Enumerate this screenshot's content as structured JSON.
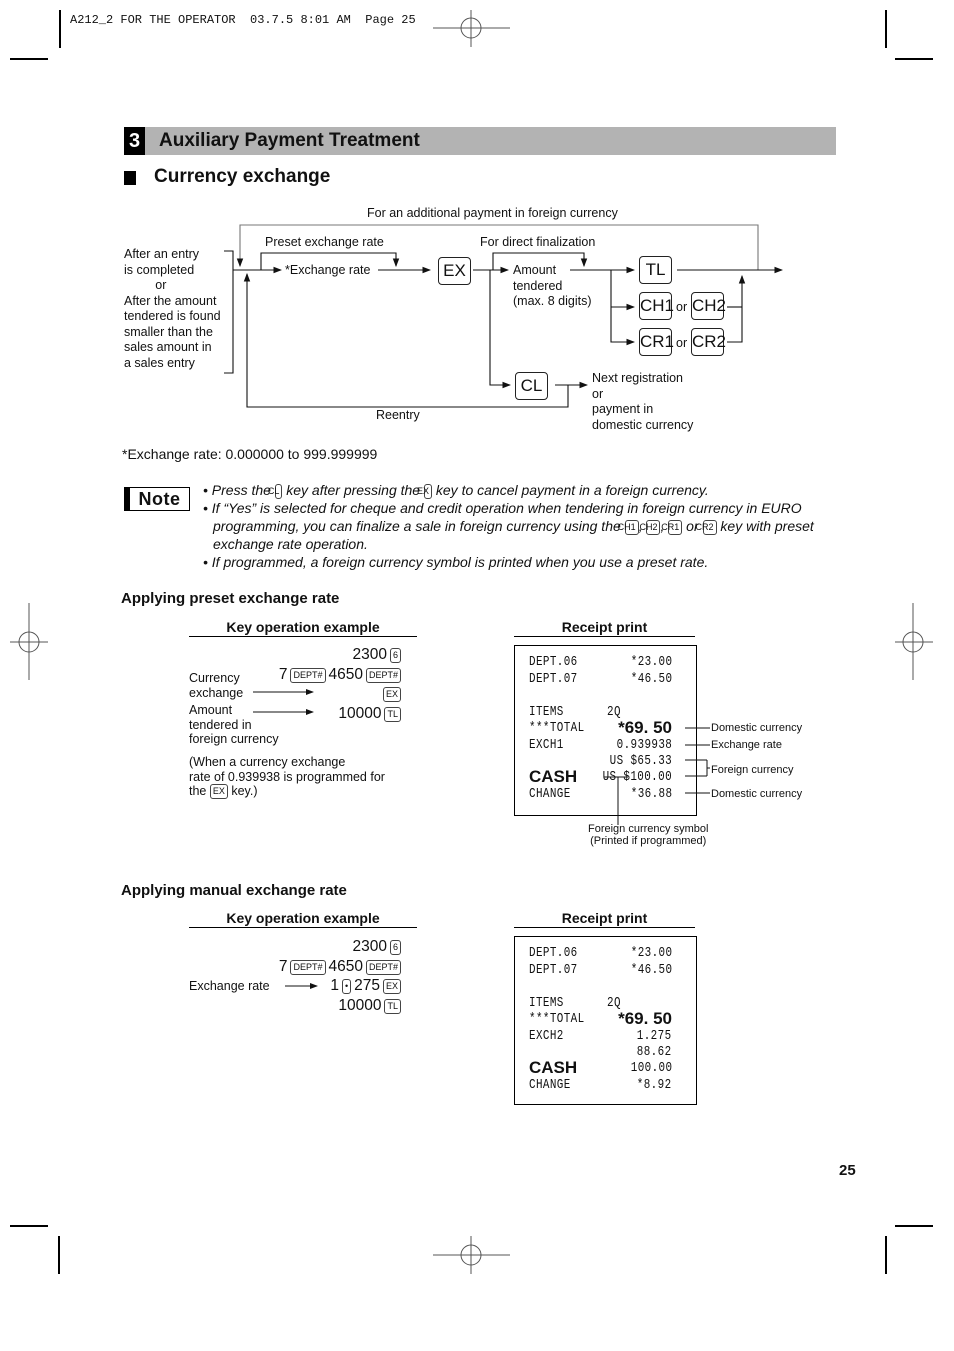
{
  "print_header": "A212_2 FOR THE OPERATOR  03.7.5 8:01 AM  Page 25",
  "section": {
    "number": "3",
    "title": "Auxiliary Payment Treatment"
  },
  "subsection": {
    "title": "Currency exchange"
  },
  "flow": {
    "top_label": "For an additional payment in foreign currency",
    "preset_label": "Preset exchange rate",
    "direct_label": "For direct finalization",
    "left_note": "After an entry\nis completed\n         or\nAfter the amount\ntendered is found\nsmaller than the\nsales amount in\na sales entry",
    "exchange_rate": "*Exchange rate",
    "amount_tendered": "Amount\ntendered\n(max. 8 digits)",
    "next_label": "Next registration\nor\npayment in\ndomestic currency",
    "reentry": "Reentry",
    "or": "or",
    "keys": {
      "ex": "EX",
      "tl": "TL",
      "ch1": "CH1",
      "ch2": "CH2",
      "cr1": "CR1",
      "cr2": "CR2",
      "cl": "CL"
    }
  },
  "footnote": "*Exchange rate: 0.000000 to 999.999999",
  "note": {
    "label": "Note",
    "items": [
      {
        "parts": [
          "• Press the ",
          "CL",
          " key after pressing the ",
          "EX",
          " key to cancel payment in a foreign currency."
        ]
      },
      {
        "parts": [
          "• If “Yes” is selected for cheque and credit operation when tendering in foreign currency in EURO programming, you can finalize a sale in foreign currency using the ",
          "CH1",
          ", ",
          "CH2",
          ", ",
          "CR1",
          " or ",
          "CR2",
          " key with preset exchange rate operation."
        ]
      },
      {
        "parts": [
          "• If programmed, a foreign currency symbol is printed when you use a preset rate."
        ]
      }
    ]
  },
  "preset": {
    "heading": "Applying preset exchange rate",
    "key_op_heading": "Key operation example",
    "receipt_heading": "Receipt print",
    "lines": [
      {
        "pre": "2300",
        "k1": "6"
      },
      {
        "pre": "7",
        "k0": "DEPT#",
        "mid": "4650",
        "k1": "DEPT#"
      },
      {
        "k1": "EX"
      },
      {
        "pre": "10000",
        "k1": "TL"
      }
    ],
    "label_currency_exchange": "Currency\nexchange",
    "label_amount": "Amount\ntendered in\nforeign currency",
    "paren_note_a": "(When a currency exchange\nrate of 0.939938 is programmed for\nthe ",
    "paren_key": "EX",
    "paren_note_b": " key.)",
    "receipt": [
      {
        "l": "DEPT.06",
        "r": "*23.00"
      },
      {
        "l": "DEPT.07",
        "r": "*46.50"
      },
      {
        "l": "ITEMS",
        "m": "2Q"
      },
      {
        "l": "***TOTAL",
        "r": "*69. 50"
      },
      {
        "l": "EXCH1",
        "r": "0.939938"
      },
      {
        "r": "US $65.33"
      },
      {
        "l": "CASH",
        "r": "US $100.00"
      },
      {
        "l": "CHANGE",
        "r": "*36.88"
      }
    ],
    "callouts": {
      "domestic1": "Domestic currency",
      "rate": "Exchange rate",
      "foreign": "Foreign currency",
      "domestic2": "Domestic currency",
      "symbol": "Foreign currency symbol\n(Printed if programmed)"
    }
  },
  "manual": {
    "heading": "Applying manual exchange rate",
    "key_op_heading": "Key operation example",
    "receipt_heading": "Receipt print",
    "label_rate": "Exchange rate",
    "lines": [
      {
        "pre": "2300",
        "k1": "6"
      },
      {
        "pre": "7",
        "k0": "DEPT#",
        "mid": "4650",
        "k1": "DEPT#"
      },
      {
        "pre": "1",
        "k0": "•",
        "mid": "275",
        "k1": "EX"
      },
      {
        "pre": "10000",
        "k1": "TL"
      }
    ],
    "receipt": [
      {
        "l": "DEPT.06",
        "r": "*23.00"
      },
      {
        "l": "DEPT.07",
        "r": "*46.50"
      },
      {
        "l": "ITEMS",
        "m": "2Q"
      },
      {
        "l": "***TOTAL",
        "r": "*69. 50"
      },
      {
        "l": "EXCH2",
        "r": "1.275"
      },
      {
        "r": "88.62"
      },
      {
        "l": "CASH",
        "r": "100.00"
      },
      {
        "l": "CHANGE",
        "r": "*8.92"
      }
    ]
  },
  "page_number": "25"
}
